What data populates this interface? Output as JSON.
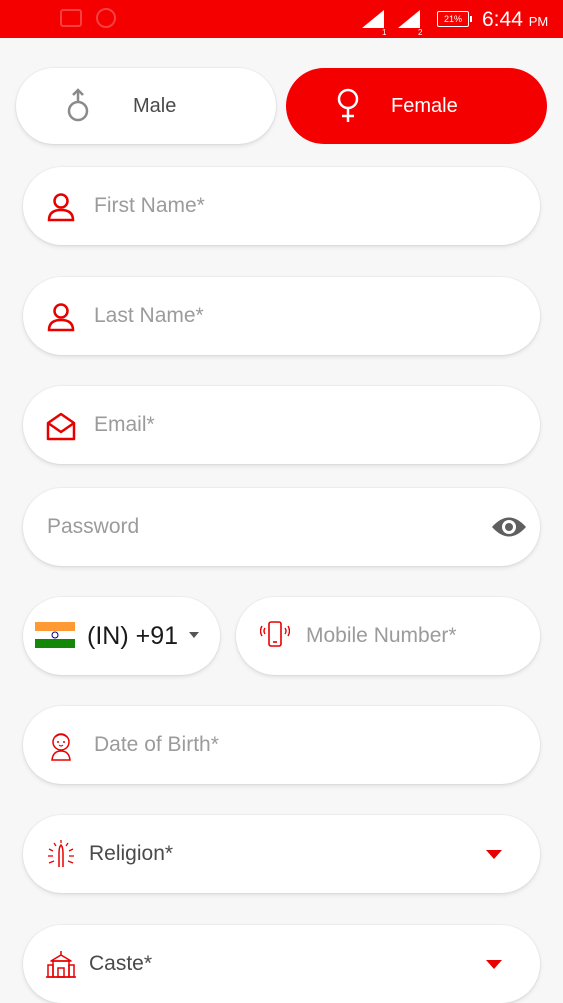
{
  "status_bar": {
    "sim1": "1",
    "sim2": "2",
    "battery": "21%",
    "time": "6:44",
    "ampm": "PM",
    "bg_color": "#f40000"
  },
  "gender": {
    "male_label": "Male",
    "male_icon": "male-symbol-icon",
    "female_label": "Female",
    "female_icon": "female-symbol-icon",
    "selected": "Female"
  },
  "form": {
    "first_name": {
      "placeholder": "First Name*",
      "icon": "user-icon"
    },
    "last_name": {
      "placeholder": "Last Name*",
      "icon": "user-icon"
    },
    "email": {
      "placeholder": "Email*",
      "icon": "envelope-open-icon"
    },
    "password": {
      "placeholder": "Password",
      "icon": "eye-icon"
    },
    "country_code": {
      "value": "(IN) +91",
      "icon": "india-flag-icon"
    },
    "mobile": {
      "placeholder": "Mobile Number*",
      "icon": "mobile-phone-icon"
    },
    "dob": {
      "placeholder": "Date of Birth*",
      "icon": "baby-icon"
    },
    "religion": {
      "label": "Religion*",
      "icon": "praying-hands-icon"
    },
    "caste": {
      "label": "Caste*",
      "icon": "temple-icon"
    }
  },
  "colors": {
    "accent": "#f40000",
    "placeholder": "#9b9b9b",
    "text": "#4a4a4a",
    "background": "#f7f7f8"
  }
}
